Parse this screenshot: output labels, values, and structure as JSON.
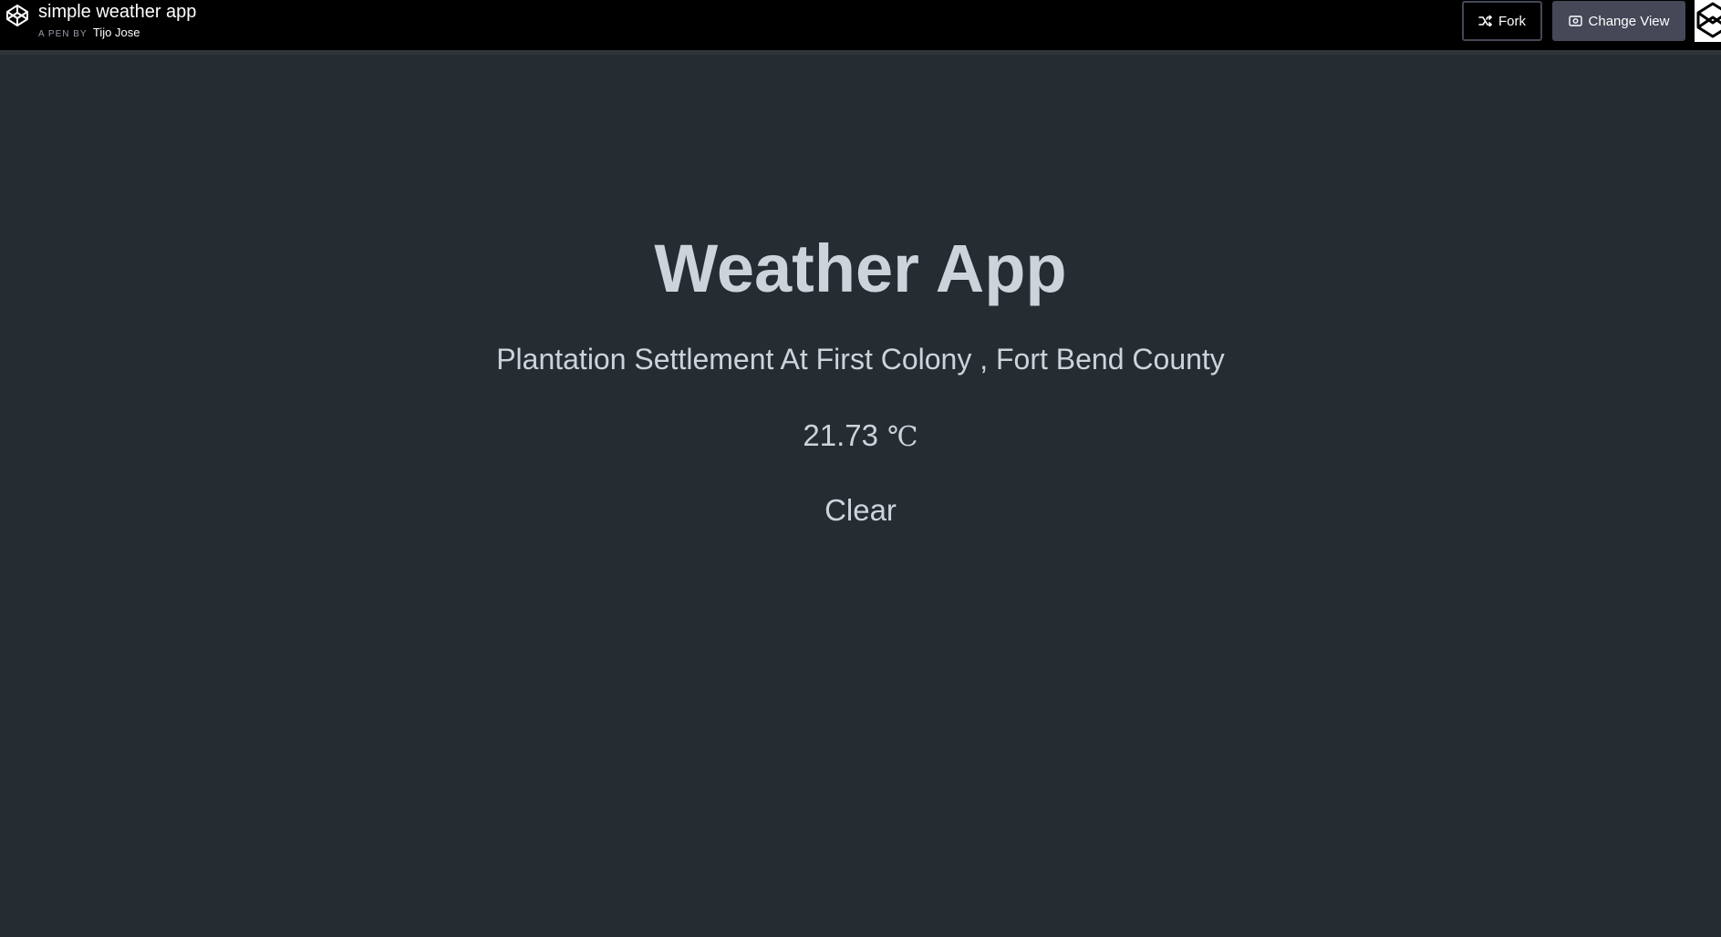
{
  "header": {
    "title": "simple weather app",
    "by_label": "A PEN BY",
    "author": "Tijo Jose",
    "fork_label": "Fork",
    "change_view_label": "Change View",
    "logo_icon": "codepen-logo-icon",
    "fork_icon": "fork-icon",
    "change_view_icon": "eye-icon"
  },
  "app": {
    "title": "Weather App",
    "location": "Plantation Settlement At First Colony , Fort Bend County",
    "temperature": "21.73",
    "unit": "℃",
    "condition": "Clear"
  },
  "colors": {
    "background": "#252d33",
    "text": "#cdd3db",
    "topbar": "#000000",
    "button": "#444857"
  }
}
